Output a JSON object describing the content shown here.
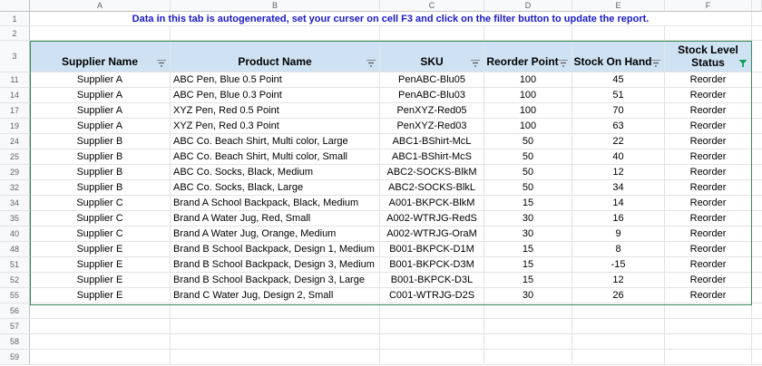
{
  "columns": [
    "A",
    "B",
    "C",
    "D",
    "E",
    "F"
  ],
  "banner": "Data in this tab is autogenerated, set your curser on cell F3 and click on the filter button to update the report.",
  "blank_rows": {
    "r1": "1",
    "r2": "2"
  },
  "header": {
    "rownum": "3",
    "labels": [
      "Supplier Name",
      "Product Name",
      "SKU",
      "Reorder Point",
      "Stock On Hand",
      "Stock Level Status"
    ],
    "active_filter_color": "#0f9d58"
  },
  "rows": [
    {
      "n": "11",
      "supplier": "Supplier A",
      "product": "ABC Pen, Blue 0.5 Point",
      "sku": "PenABC-Blu05",
      "reorder": "100",
      "onhand": "45",
      "status": "Reorder"
    },
    {
      "n": "14",
      "supplier": "Supplier A",
      "product": "ABC Pen, Blue 0.3 Point",
      "sku": "PenABC-Blu03",
      "reorder": "100",
      "onhand": "51",
      "status": "Reorder"
    },
    {
      "n": "17",
      "supplier": "Supplier A",
      "product": "XYZ Pen, Red 0.5 Point",
      "sku": "PenXYZ-Red05",
      "reorder": "100",
      "onhand": "70",
      "status": "Reorder"
    },
    {
      "n": "19",
      "supplier": "Supplier A",
      "product": "XYZ Pen, Red 0.3 Point",
      "sku": "PenXYZ-Red03",
      "reorder": "100",
      "onhand": "63",
      "status": "Reorder"
    },
    {
      "n": "24",
      "supplier": "Supplier B",
      "product": "ABC Co. Beach Shirt, Multi color, Large",
      "sku": "ABC1-BShirt-McL",
      "reorder": "50",
      "onhand": "22",
      "status": "Reorder"
    },
    {
      "n": "25",
      "supplier": "Supplier B",
      "product": "ABC Co. Beach Shirt, Multi color, Small",
      "sku": "ABC1-BShirt-McS",
      "reorder": "50",
      "onhand": "40",
      "status": "Reorder"
    },
    {
      "n": "29",
      "supplier": "Supplier B",
      "product": "ABC Co. Socks, Black, Medium",
      "sku": "ABC2-SOCKS-BlkM",
      "reorder": "50",
      "onhand": "12",
      "status": "Reorder"
    },
    {
      "n": "32",
      "supplier": "Supplier B",
      "product": "ABC Co. Socks, Black, Large",
      "sku": "ABC2-SOCKS-BlkL",
      "reorder": "50",
      "onhand": "34",
      "status": "Reorder"
    },
    {
      "n": "34",
      "supplier": "Supplier C",
      "product": "Brand A School Backpack, Black, Medium",
      "sku": "A001-BKPCK-BlkM",
      "reorder": "15",
      "onhand": "14",
      "status": "Reorder"
    },
    {
      "n": "35",
      "supplier": "Supplier C",
      "product": "Brand A Water Jug, Red, Small",
      "sku": "A002-WTRJG-RedS",
      "reorder": "30",
      "onhand": "16",
      "status": "Reorder"
    },
    {
      "n": "40",
      "supplier": "Supplier C",
      "product": "Brand A Water Jug, Orange, Medium",
      "sku": "A002-WTRJG-OraM",
      "reorder": "30",
      "onhand": "9",
      "status": "Reorder"
    },
    {
      "n": "48",
      "supplier": "Supplier E",
      "product": "Brand B School Backpack, Design 1, Medium",
      "sku": "B001-BKPCK-D1M",
      "reorder": "15",
      "onhand": "8",
      "status": "Reorder"
    },
    {
      "n": "51",
      "supplier": "Supplier E",
      "product": "Brand B School Backpack, Design 3, Medium",
      "sku": "B001-BKPCK-D3M",
      "reorder": "15",
      "onhand": "-15",
      "status": "Reorder"
    },
    {
      "n": "52",
      "supplier": "Supplier E",
      "product": "Brand B School Backpack, Design 3, Large",
      "sku": "B001-BKPCK-D3L",
      "reorder": "15",
      "onhand": "12",
      "status": "Reorder"
    },
    {
      "n": "55",
      "supplier": "Supplier E",
      "product": "Brand C Water Jug, Design 2, Small",
      "sku": "C001-WTRJG-D2S",
      "reorder": "30",
      "onhand": "26",
      "status": "Reorder"
    }
  ],
  "trailing_rows": [
    "56",
    "57",
    "58",
    "59"
  ]
}
